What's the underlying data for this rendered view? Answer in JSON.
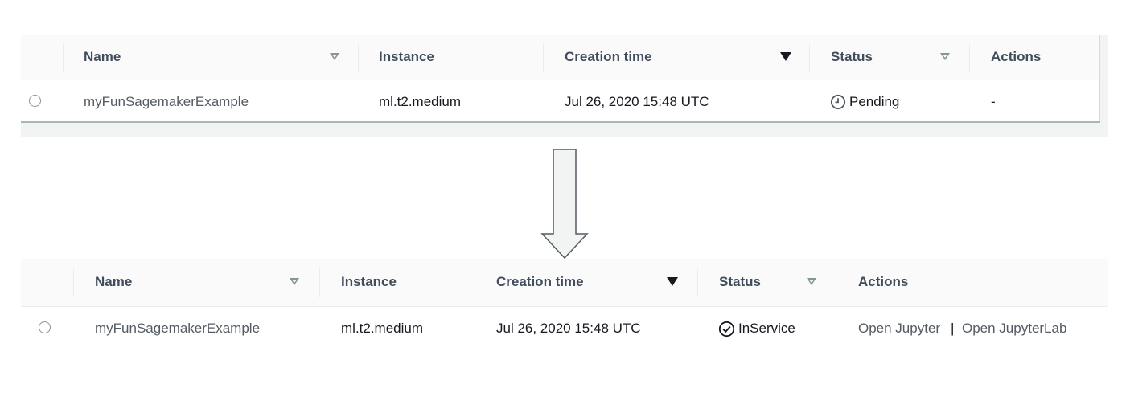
{
  "before": {
    "columns": {
      "name": "Name",
      "instance": "Instance",
      "creation_time": "Creation time",
      "status": "Status",
      "actions": "Actions"
    },
    "row": {
      "name": "myFunSagemakerExample",
      "instance": "ml.t2.medium",
      "creation_time": "Jul 26, 2020 15:48 UTC",
      "status": "Pending",
      "status_icon": "clock-icon",
      "actions": "-"
    }
  },
  "after": {
    "columns": {
      "name": "Name",
      "instance": "Instance",
      "creation_time": "Creation time",
      "status": "Status",
      "actions": "Actions"
    },
    "row": {
      "name": "myFunSagemakerExample",
      "instance": "ml.t2.medium",
      "creation_time": "Jul 26, 2020 15:48 UTC",
      "status": "InService",
      "status_icon": "check-circle-icon",
      "action_open_jupyter": "Open Jupyter",
      "action_separator": "|",
      "action_open_jupyterlab": "Open JupyterLab"
    }
  },
  "transition_arrow_icon": "down-arrow-icon",
  "colors": {
    "header_bg": "#fafafa",
    "link": "#545b64",
    "header_text": "#414d5c"
  }
}
